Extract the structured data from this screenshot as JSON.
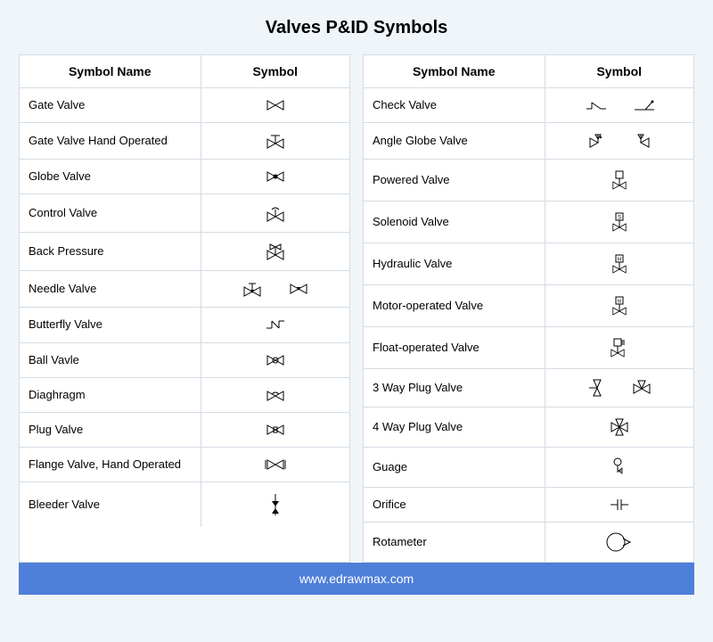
{
  "title": "Valves P&ID Symbols",
  "headers": {
    "name": "Symbol Name",
    "symbol": "Symbol"
  },
  "left_table": [
    {
      "name": "Gate Valve",
      "icon": "gate-valve"
    },
    {
      "name": "Gate Valve Hand Operated",
      "icon": "gate-valve-hand"
    },
    {
      "name": "Globe Valve",
      "icon": "globe-valve"
    },
    {
      "name": "Control Valve",
      "icon": "control-valve"
    },
    {
      "name": "Back Pressure",
      "icon": "back-pressure"
    },
    {
      "name": "Needle Valve",
      "icon": "needle-valve"
    },
    {
      "name": "Butterfly Valve",
      "icon": "butterfly-valve"
    },
    {
      "name": "Ball Vavle",
      "icon": "ball-valve"
    },
    {
      "name": "Diaghragm",
      "icon": "diaphragm"
    },
    {
      "name": "Plug Valve",
      "icon": "plug-valve"
    },
    {
      "name": "Flange Valve, Hand Operated",
      "icon": "flange-valve"
    },
    {
      "name": "Bleeder Valve",
      "icon": "bleeder-valve"
    }
  ],
  "right_table": [
    {
      "name": "Check Valve",
      "icon": "check-valve"
    },
    {
      "name": "Angle Globe Valve",
      "icon": "angle-globe-valve"
    },
    {
      "name": "Powered Valve",
      "icon": "powered-valve"
    },
    {
      "name": "Solenoid Valve",
      "icon": "solenoid-valve"
    },
    {
      "name": "Hydraulic Valve",
      "icon": "hydraulic-valve"
    },
    {
      "name": "Motor-operated Valve",
      "icon": "motor-operated-valve"
    },
    {
      "name": "Float-operated Valve",
      "icon": "float-operated-valve"
    },
    {
      "name": "3 Way Plug Valve",
      "icon": "three-way-plug"
    },
    {
      "name": "4 Way Plug Valve",
      "icon": "four-way-plug"
    },
    {
      "name": "Guage",
      "icon": "gauge"
    },
    {
      "name": "Orifice",
      "icon": "orifice"
    },
    {
      "name": "Rotameter",
      "icon": "rotameter"
    }
  ],
  "footer": "www.edrawmax.com"
}
